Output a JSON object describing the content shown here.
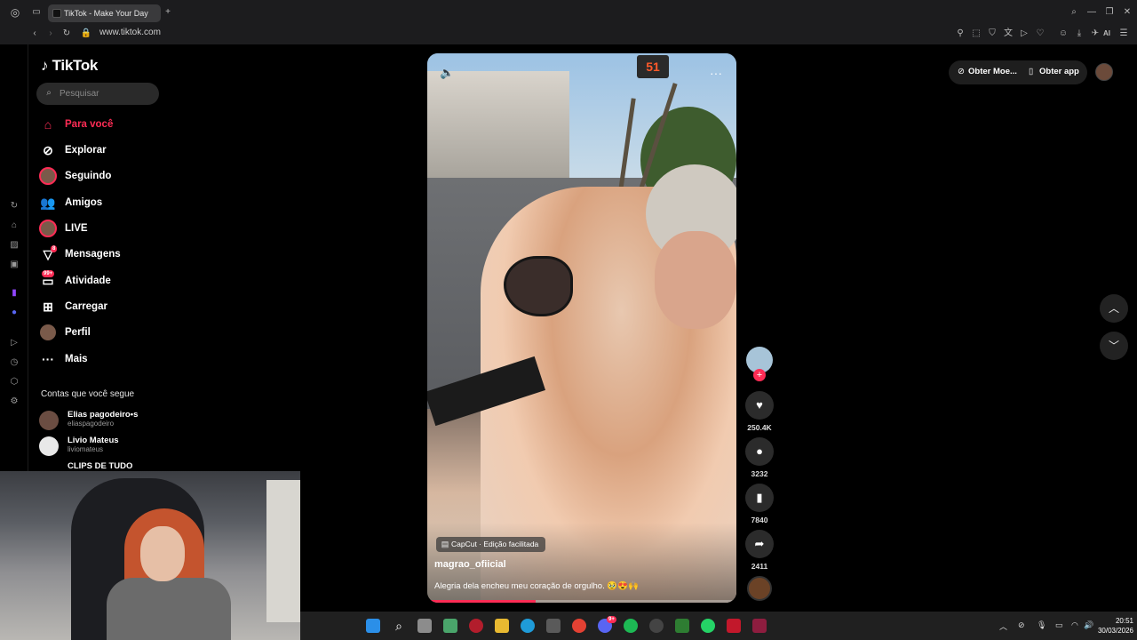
{
  "browser": {
    "tab_title": "TikTok - Make Your Day",
    "new_tab": "+",
    "url": "www.tiktok.com",
    "ai_label": "AI"
  },
  "sidebar": {
    "logo": "TikTok",
    "search_placeholder": "Pesquisar",
    "nav": [
      {
        "label": "Para você",
        "icon": "home-icon",
        "active": true
      },
      {
        "label": "Explorar",
        "icon": "compass-icon"
      },
      {
        "label": "Seguindo",
        "icon": "following-avatar-icon"
      },
      {
        "label": "Amigos",
        "icon": "friends-icon"
      },
      {
        "label": "LIVE",
        "icon": "live-avatar-icon"
      },
      {
        "label": "Mensagens",
        "icon": "messages-icon",
        "badge": "8"
      },
      {
        "label": "Atividade",
        "icon": "activity-icon",
        "badge": "99+"
      },
      {
        "label": "Carregar",
        "icon": "upload-icon"
      },
      {
        "label": "Perfil",
        "icon": "profile-avatar-icon"
      },
      {
        "label": "Mais",
        "icon": "more-icon"
      }
    ],
    "following_header": "Contas que você segue",
    "accounts": [
      {
        "name": "Elias pagodeiro•s",
        "handle": "eliaspagodeiro"
      },
      {
        "name": "Livio Mateus",
        "handle": "liviomateus"
      },
      {
        "name": "CLIPS DE TUDO",
        "handle": ""
      }
    ]
  },
  "video": {
    "tag": "CapCut · Edição facilitada",
    "author": "magrao_ofiicial",
    "description": "Alegria dela encheu meu coração de orgulho. 🥹😍🙌",
    "progress": 0.35,
    "traffic_number": "51"
  },
  "actions": {
    "likes": "250.4K",
    "comments": "3232",
    "saves": "7840",
    "shares": "2411"
  },
  "topright": {
    "coins": "Obter Moe...",
    "app": "Obter app"
  },
  "taskbar": {
    "time": "20:51",
    "date": "30/03/2026",
    "badge": "9+"
  },
  "colors": {
    "accent": "#fe2c55",
    "background": "#000000",
    "chrome": "#1c1c1e"
  }
}
